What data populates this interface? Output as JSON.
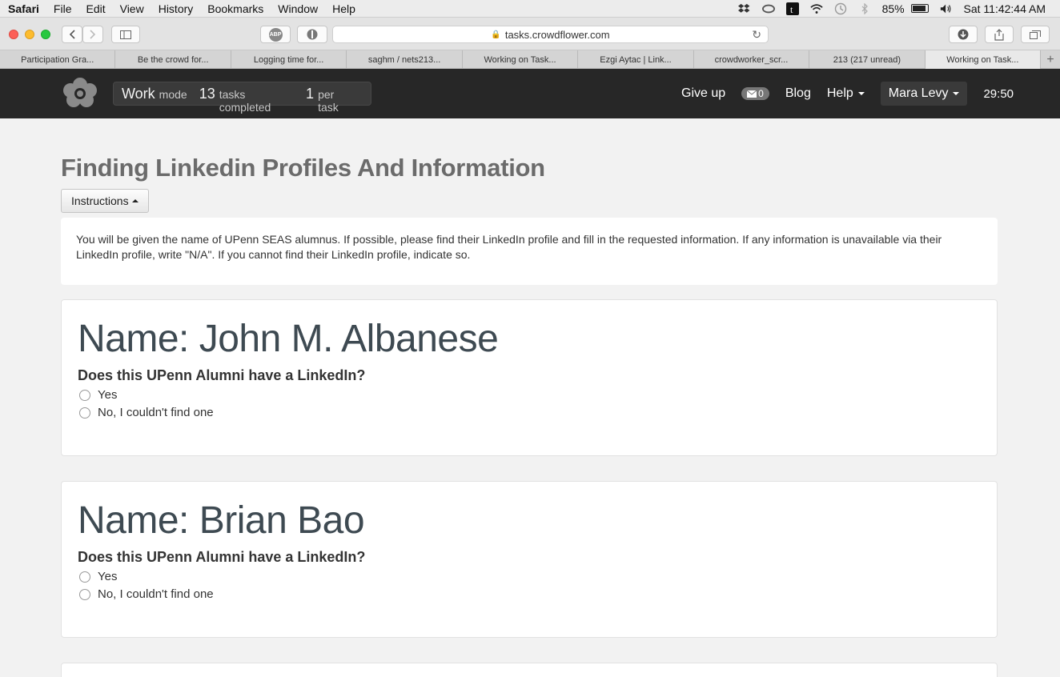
{
  "menubar": {
    "app": "Safari",
    "items": [
      "File",
      "Edit",
      "View",
      "History",
      "Bookmarks",
      "Window",
      "Help"
    ],
    "battery": "85%",
    "clock": "Sat 11:42:44 AM"
  },
  "toolbar": {
    "url": "tasks.crowdflower.com",
    "abp_label": "ABP"
  },
  "tabs": [
    "Participation Gra...",
    "Be the crowd for...",
    "Logging time for...",
    "saghm / nets213...",
    "Working on Task...",
    "Ezgi Aytac | Link...",
    "crowdworker_scr...",
    "213 (217 unread)",
    "Working on Task..."
  ],
  "navbar": {
    "mode_value": "Work",
    "mode_label": "mode",
    "tasks_value": "13",
    "tasks_label": "tasks completed",
    "per_value": "1",
    "per_label": "per task",
    "give_up": "Give up",
    "mail_count": "0",
    "blog": "Blog",
    "help": "Help",
    "user": "Mara Levy",
    "timer": "29:50"
  },
  "page": {
    "title": "Finding Linkedin Profiles And Information",
    "instructions_button": "Instructions",
    "instructions_text": "You will be given the name of UPenn SEAS alumnus. If possible, please find their LinkedIn profile and fill in the requested information. If any information is unavailable via their LinkedIn profile, write \"N/A\". If you cannot find their LinkedIn profile, indicate so."
  },
  "cards": [
    {
      "name": "Name: John M. Albanese",
      "question": "Does this UPenn Alumni have a LinkedIn?",
      "options": [
        "Yes",
        "No, I couldn't find one"
      ]
    },
    {
      "name": "Name: Brian Bao",
      "question": "Does this UPenn Alumni have a LinkedIn?",
      "options": [
        "Yes",
        "No, I couldn't find one"
      ]
    }
  ]
}
